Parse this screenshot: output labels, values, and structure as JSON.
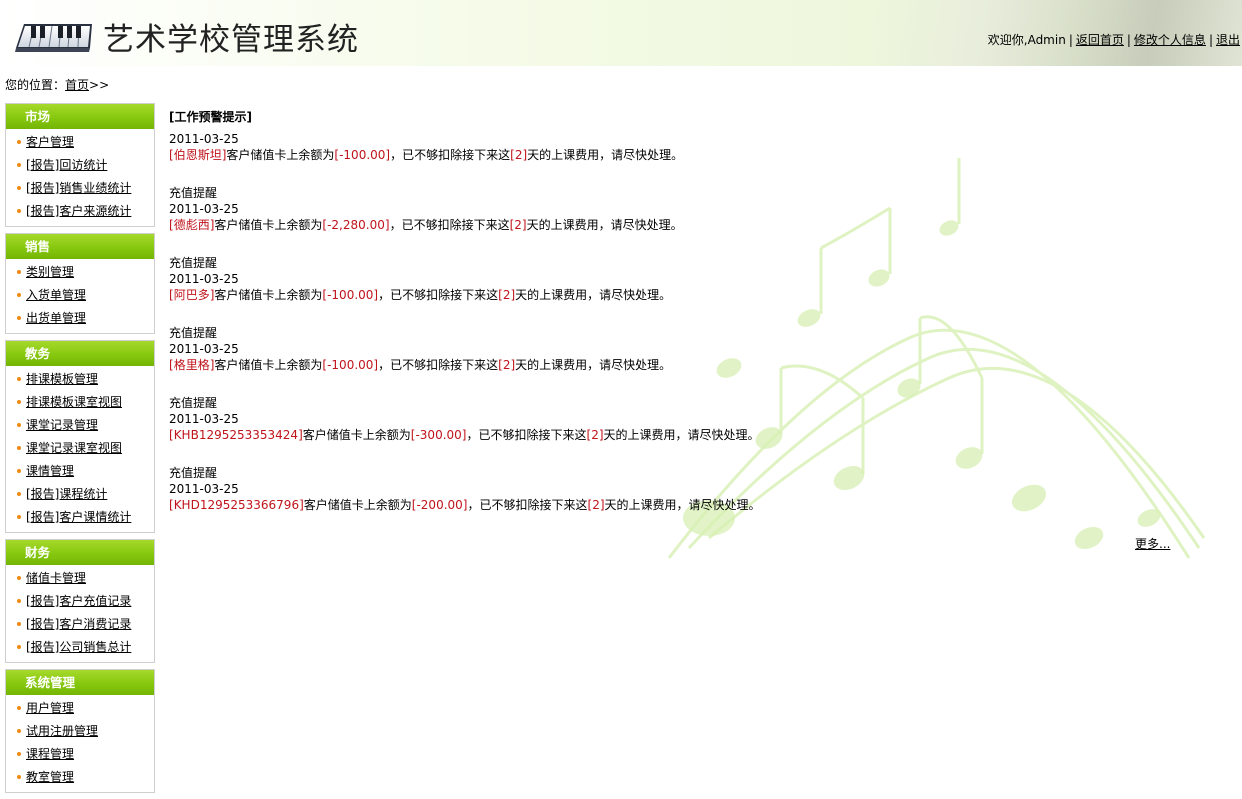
{
  "header": {
    "title": "艺术学校管理系统",
    "greeting": "欢迎你,Admin",
    "links": [
      "返回首页",
      "修改个人信息",
      "退出"
    ]
  },
  "breadcrumb": {
    "prefix": "您的位置：",
    "home": "首页",
    "suffix": ">>"
  },
  "sidebar": [
    {
      "title": "市场",
      "items": [
        "客户管理",
        "[报告]回访统计",
        "[报告]销售业绩统计",
        "[报告]客户来源统计"
      ]
    },
    {
      "title": "销售",
      "items": [
        "类别管理",
        "入货单管理",
        "出货单管理"
      ]
    },
    {
      "title": "教务",
      "items": [
        "排课模板管理",
        "排课模板课室视图",
        "课堂记录管理",
        "课堂记录课室视图",
        "课情管理",
        "[报告]课程统计",
        "[报告]客户课情统计"
      ]
    },
    {
      "title": "财务",
      "items": [
        "储值卡管理",
        "[报告]客户充值记录",
        "[报告]客户消费记录",
        "[报告]公司销售总计"
      ]
    },
    {
      "title": "系统管理",
      "items": [
        "用户管理",
        "试用注册管理",
        "课程管理",
        "教室管理"
      ]
    }
  ],
  "main": {
    "section_title": "[工作预警提示]",
    "alerts": [
      {
        "heading": "",
        "date": "2011-03-25",
        "customer": "伯恩斯坦",
        "amount": "-100.00",
        "days": "2"
      },
      {
        "heading": "充值提醒",
        "date": "2011-03-25",
        "customer": "德彪西",
        "amount": "-2,280.00",
        "days": "2"
      },
      {
        "heading": "充值提醒",
        "date": "2011-03-25",
        "customer": "阿巴多",
        "amount": "-100.00",
        "days": "2"
      },
      {
        "heading": "充值提醒",
        "date": "2011-03-25",
        "customer": "格里格",
        "amount": "-100.00",
        "days": "2"
      },
      {
        "heading": "充值提醒",
        "date": "2011-03-25",
        "customer": "KHB1295253353424",
        "amount": "-300.00",
        "days": "2"
      },
      {
        "heading": "充值提醒",
        "date": "2011-03-25",
        "customer": "KHD1295253366796",
        "amount": "-200.00",
        "days": "2"
      }
    ],
    "text": {
      "balance_prefix": "客户储值卡上余额为",
      "insufficient": "，已不够扣除接下来这",
      "days_suffix": "天的上课费用，请尽快处理。"
    },
    "more_label": "更多..."
  },
  "colors": {
    "menu_header": "#86c80f",
    "bullet": "#f08a14",
    "highlight": "#c0141b"
  }
}
